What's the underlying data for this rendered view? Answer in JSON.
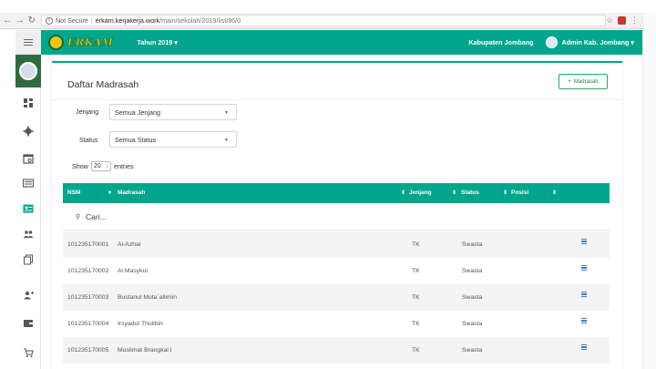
{
  "browser": {
    "security": "Not Secure",
    "host": "erkam.kerjakerja.work",
    "path": "/main/sekolah/2019/list/86/0"
  },
  "header": {
    "logo_text": "ERKAM",
    "year": "Tahun 2019 ▾",
    "region": "Kabupaten Jombang",
    "user": "Admin Kab. Jombang ▾"
  },
  "panel": {
    "title": "Daftar Madrasah",
    "add_button": "Madrasah",
    "filters": {
      "jenjang_label": "Jenjang",
      "jenjang_value": "Semua Jenjang",
      "status_label": "Status",
      "status_value": "Semua Status"
    },
    "show": {
      "prefix": "Show",
      "value": "20",
      "suffix": "entries"
    }
  },
  "table": {
    "columns": [
      "NSM",
      "Madrasah",
      "Jenjang",
      "Status",
      "Posisi"
    ],
    "search_placeholder": "Cari...",
    "rows": [
      {
        "nsm": "101235170001",
        "madrasah": "Al-Azhar",
        "jenjang": "TK",
        "status": "Swasta"
      },
      {
        "nsm": "101235170002",
        "madrasah": "Al Masykur",
        "jenjang": "TK",
        "status": "Swasta"
      },
      {
        "nsm": "101235170003",
        "madrasah": "Bustanul Muta`allimin",
        "jenjang": "TK",
        "status": "Swasta"
      },
      {
        "nsm": "101235170004",
        "madrasah": "Irsyadut Tholibin",
        "jenjang": "TK",
        "status": "Swasta"
      },
      {
        "nsm": "101235170005",
        "madrasah": "Muslimat Brangkal I",
        "jenjang": "TK",
        "status": "Swasta"
      }
    ]
  },
  "icons": {
    "sidebar": [
      "dashboard-icon",
      "gear-icon",
      "calendar-icon",
      "id-card-icon",
      "contact-card-icon",
      "users-icon",
      "copy-icon",
      "add-user-icon",
      "wallet-icon",
      "cart-icon"
    ],
    "row_action": "menu-icon"
  },
  "colors": {
    "primary": "#01a68c",
    "sidebar_active": "#2e6b3e",
    "add_button": "#27ae60",
    "row_menu": "#3e7ec7"
  }
}
